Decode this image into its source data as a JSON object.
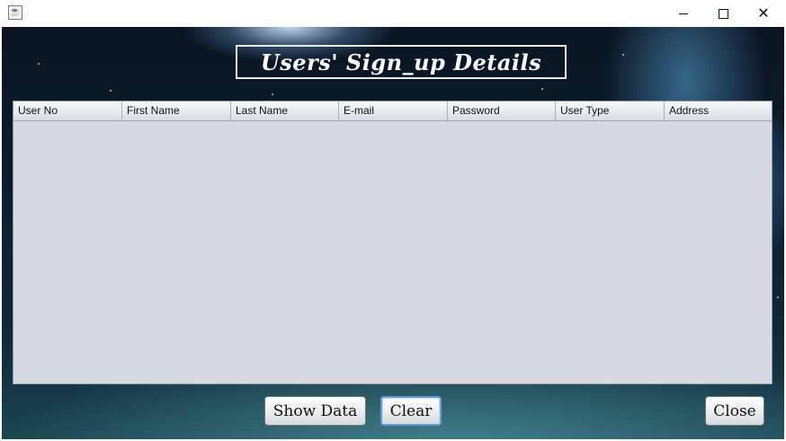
{
  "window": {
    "app_icon": "java-cup-icon",
    "controls": {
      "minimize": "minimize-icon",
      "maximize": "maximize-icon",
      "close": "close-icon"
    }
  },
  "heading": "Users' Sign_up Details",
  "table": {
    "columns": [
      "User No",
      "First Name",
      "Last Name",
      "E-mail",
      "Password",
      "User Type",
      "Address"
    ],
    "rows": []
  },
  "buttons": {
    "show_data": "Show Data",
    "clear": "Clear",
    "close": "Close"
  },
  "colors": {
    "table_background": "#d7dae2",
    "focus_ring": "#6b9bd1"
  }
}
